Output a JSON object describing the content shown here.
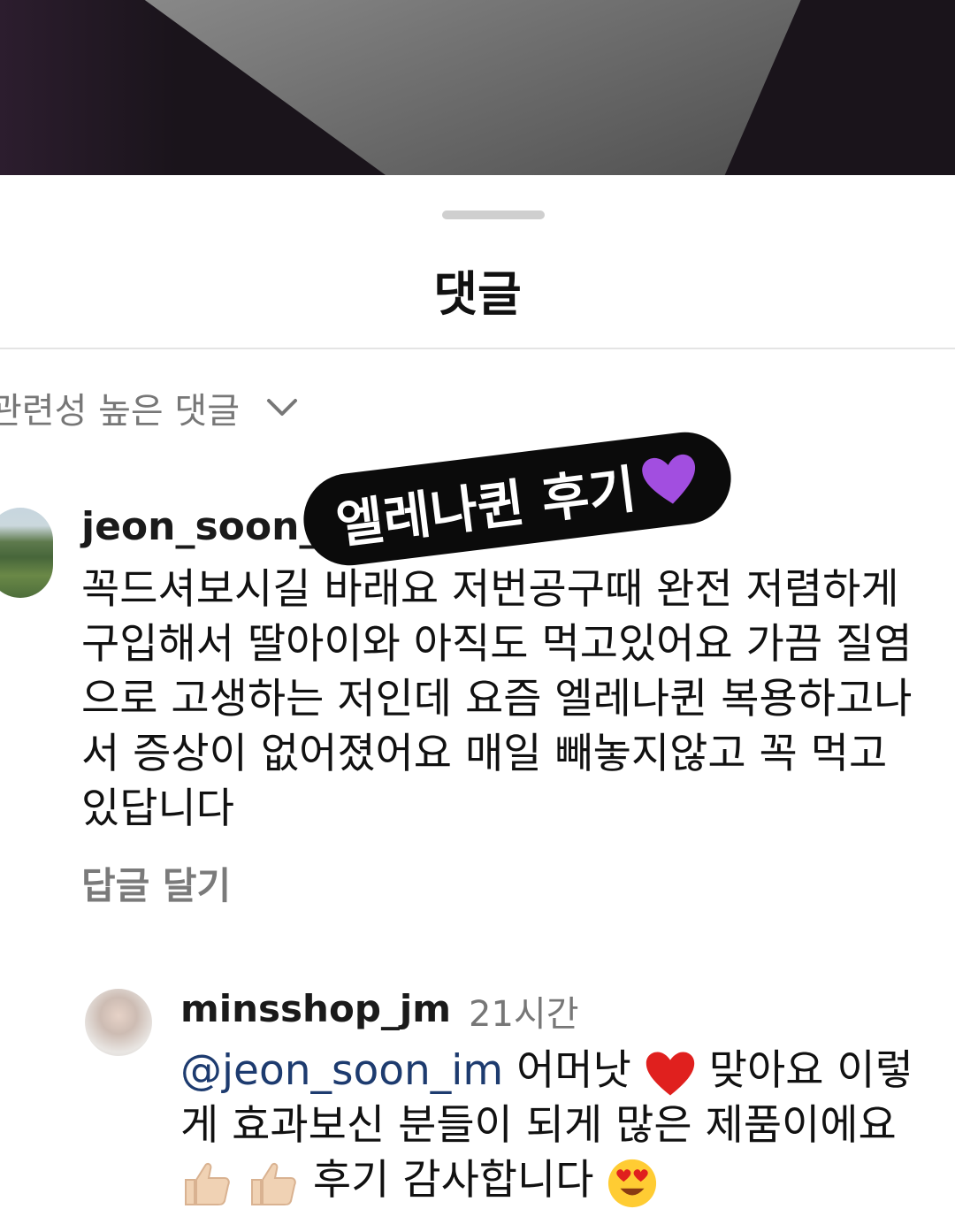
{
  "sheet": {
    "title": "댓글"
  },
  "sort": {
    "label": "관련성 높은 댓글"
  },
  "sticker": {
    "text": "엘레나퀸 후기"
  },
  "comment": {
    "username": "jeon_soon_",
    "text": "꼭드셔보시길 바래요 저번공구때 완전 저렴하게 구입해서 딸아이와 아직도 먹고있어요 가끔 질염으로 고생하는 저인데 요즘 엘레나퀸 복용하고나서 증상이 없어졌어요 매일 빼놓지않고 꼭 먹고있답니다",
    "reply_label": "답글 달기"
  },
  "reply": {
    "username": "minsshop_jm",
    "time": "21시간",
    "mention": "@jeon_soon_im",
    "text_a": "어머낫",
    "text_b": "맞아요 이렇게 효과보신 분들이 되게 많은 제품이에요",
    "text_c": "후기 감사합니다"
  },
  "colors": {
    "mention": "#1d3b6f",
    "sticker_bg": "#0b0b0b",
    "muted": "#777777"
  },
  "icons": [
    "chevron-down-icon",
    "purple-heart-icon",
    "red-heart-icon",
    "thumbs-up-icon",
    "heart-eyes-icon"
  ]
}
